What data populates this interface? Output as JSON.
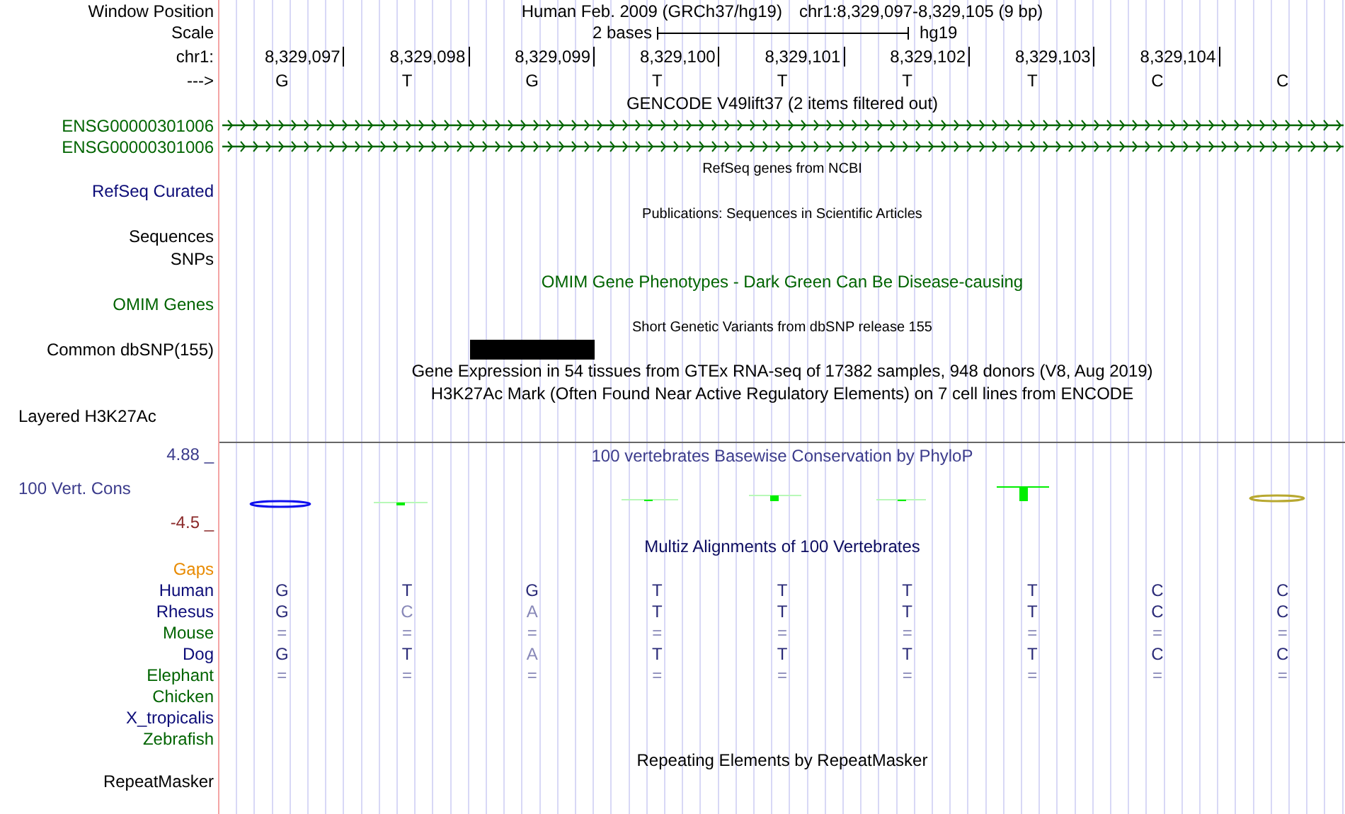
{
  "header": {
    "label": "Window Position",
    "assembly_title": "Human Feb. 2009 (GRCh37/hg19)",
    "position": "chr1:8,329,097-8,329,105 (9 bp)"
  },
  "scale": {
    "label": "Scale",
    "span": "2 bases",
    "assembly": "hg19"
  },
  "ruler": {
    "label": "chr1:",
    "ticks": [
      "8,329,097",
      "8,329,098",
      "8,329,099",
      "8,329,100",
      "8,329,101",
      "8,329,102",
      "8,329,103",
      "8,329,104"
    ]
  },
  "sequence": {
    "label": "--->",
    "bases": [
      "G",
      "T",
      "G",
      "T",
      "T",
      "T",
      "T",
      "C",
      "C"
    ]
  },
  "tracks": [
    {
      "kind": "title",
      "text": "GENCODE V49lift37 (2 items filtered out)",
      "color": "#000000"
    },
    {
      "kind": "gene",
      "label": "ENSG00000301006",
      "color": "#006400"
    },
    {
      "kind": "gene",
      "label": "ENSG00000301006",
      "color": "#006400"
    },
    {
      "kind": "subtitle",
      "text": "RefSeq genes from NCBI",
      "color": "#000000"
    },
    {
      "kind": "label",
      "label": "RefSeq Curated",
      "color": "#0c0c78"
    },
    {
      "kind": "subtitle",
      "text": "Publications: Sequences in Scientific Articles",
      "color": "#000000"
    },
    {
      "kind": "label",
      "label": "Sequences",
      "color": "#000000"
    },
    {
      "kind": "label",
      "label": "SNPs",
      "color": "#000000"
    },
    {
      "kind": "title",
      "text": "OMIM Gene Phenotypes - Dark Green Can Be Disease-causing",
      "color": "#006400"
    },
    {
      "kind": "label",
      "label": "OMIM Genes",
      "color": "#006400"
    },
    {
      "kind": "subtitle",
      "text": "Short Genetic Variants from dbSNP release 155",
      "color": "#000000"
    },
    {
      "kind": "snp",
      "label": "Common dbSNP(155)",
      "color": "#000000"
    },
    {
      "kind": "title",
      "text": "Gene Expression in 54 tissues from GTEx RNA-seq of 17382 samples, 948 donors (V8, Aug 2019)",
      "color": "#000000"
    },
    {
      "kind": "title",
      "text": "H3K27Ac Mark (Often Found Near Active Regulatory Elements) on 7 cell lines from ENCODE",
      "color": "#000000"
    },
    {
      "kind": "composite",
      "label": "Layered H3K27Ac",
      "color": "#000000"
    }
  ],
  "conservation": {
    "title": "100 vertebrates Basewise Conservation by PhyloP",
    "label": "100 Vert. Cons",
    "max": "4.88 _",
    "min": "-4.5 _"
  },
  "alignment": {
    "title": "Multiz Alignments of 100 Vertebrates",
    "gaps_label": "Gaps",
    "species": [
      {
        "name": "Human",
        "color": "#0c0c78",
        "bases": [
          {
            "base": "G",
            "faded": false
          },
          {
            "base": "T",
            "faded": false
          },
          {
            "base": "G",
            "faded": false
          },
          {
            "base": "T",
            "faded": false
          },
          {
            "base": "T",
            "faded": false
          },
          {
            "base": "T",
            "faded": false
          },
          {
            "base": "T",
            "faded": false
          },
          {
            "base": "C",
            "faded": false
          },
          {
            "base": "C",
            "faded": false
          }
        ]
      },
      {
        "name": "Rhesus",
        "color": "#0c0c78",
        "bases": [
          {
            "base": "G",
            "faded": false
          },
          {
            "base": "C",
            "faded": true
          },
          {
            "base": "A",
            "faded": true
          },
          {
            "base": "T",
            "faded": false
          },
          {
            "base": "T",
            "faded": false
          },
          {
            "base": "T",
            "faded": false
          },
          {
            "base": "T",
            "faded": false
          },
          {
            "base": "C",
            "faded": false
          },
          {
            "base": "C",
            "faded": false
          }
        ]
      },
      {
        "name": "Mouse",
        "color": "#006400",
        "bases": [
          {
            "base": "=",
            "faded": true
          },
          {
            "base": "=",
            "faded": true
          },
          {
            "base": "=",
            "faded": true
          },
          {
            "base": "=",
            "faded": true
          },
          {
            "base": "=",
            "faded": true
          },
          {
            "base": "=",
            "faded": true
          },
          {
            "base": "=",
            "faded": true
          },
          {
            "base": "=",
            "faded": true
          },
          {
            "base": "=",
            "faded": true
          }
        ]
      },
      {
        "name": "Dog",
        "color": "#0c0c78",
        "bases": [
          {
            "base": "G",
            "faded": false
          },
          {
            "base": "T",
            "faded": false
          },
          {
            "base": "A",
            "faded": true
          },
          {
            "base": "T",
            "faded": false
          },
          {
            "base": "T",
            "faded": false
          },
          {
            "base": "T",
            "faded": false
          },
          {
            "base": "T",
            "faded": false
          },
          {
            "base": "C",
            "faded": false
          },
          {
            "base": "C",
            "faded": false
          }
        ]
      },
      {
        "name": "Elephant",
        "color": "#006400",
        "bases": [
          {
            "base": "=",
            "faded": true
          },
          {
            "base": "=",
            "faded": true
          },
          {
            "base": "=",
            "faded": true
          },
          {
            "base": "=",
            "faded": true
          },
          {
            "base": "=",
            "faded": true
          },
          {
            "base": "=",
            "faded": true
          },
          {
            "base": "=",
            "faded": true
          },
          {
            "base": "=",
            "faded": true
          },
          {
            "base": "=",
            "faded": true
          }
        ]
      },
      {
        "name": "Chicken",
        "color": "#006400"
      },
      {
        "name": "X_tropicalis",
        "color": "#0c0c78"
      },
      {
        "name": "Zebrafish",
        "color": "#006400"
      }
    ]
  },
  "repeats": {
    "title": "Repeating Elements by RepeatMasker",
    "label": "RepeatMasker"
  }
}
